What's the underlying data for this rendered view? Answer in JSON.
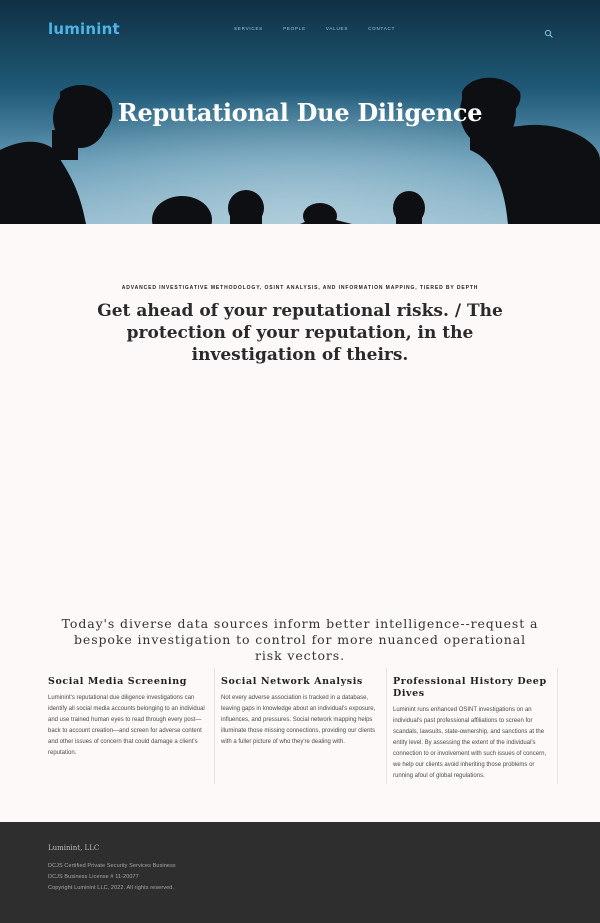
{
  "header": {
    "logo": "luminint",
    "nav": [
      "SERVICES",
      "PEOPLE",
      "VALUES",
      "CONTACT"
    ]
  },
  "hero": {
    "title": "Reputational Due Diligence"
  },
  "intro": {
    "kicker": "ADVANCED INVESTIGATIVE METHODOLOGY, OSINT ANALYSIS, AND INFORMATION MAPPING, TIERED BY DEPTH",
    "headline": "Get ahead of your reputational risks. / The protection of your reputation, in the investigation of theirs."
  },
  "cta": {
    "text": "Today's diverse data sources inform better intelligence--request a bespoke investigation to control for more nuanced operational risk vectors."
  },
  "services": [
    {
      "title": "Social Media Screening",
      "body": "Luminint's reputational due diligence investigations can identify all social media accounts belonging to an individual and use trained human eyes to read through every post—back to account creation—and screen for adverse content and other issues of concern that could damage a client's reputation."
    },
    {
      "title": "Social Network Analysis",
      "body": "Not every adverse association is tracked in a database, leaving gaps in knowledge about an individual's exposure, influences, and pressures. Social network mapping helps illuminate those missing connections, providing our clients with a fuller picture of who they're dealing with."
    },
    {
      "title": "Professional History Deep Dives",
      "body": "Luminint runs enhanced OSINT investigations on an individual's past professional affiliations to screen for scandals, lawsuits, state-ownership, and sanctions at the entity level. By assessing the extent of the individual's connection to or involvement with such issues of concern, we help our clients avoid inheriting those problems or running afoul of global regulations."
    }
  ],
  "footer": {
    "company": "Luminint, LLC",
    "line1": "DCJS Certified Private Security Services Business",
    "line2": "DCJS Business License # 11-20077",
    "line3": "Copyright Luminint LLC, 2022.  All rights reserved."
  },
  "colors": {
    "accent": "#4fb3e6",
    "page_bg": "#fcf9f8",
    "footer_bg": "#2e2e2e"
  },
  "icons": [
    "search-icon"
  ]
}
